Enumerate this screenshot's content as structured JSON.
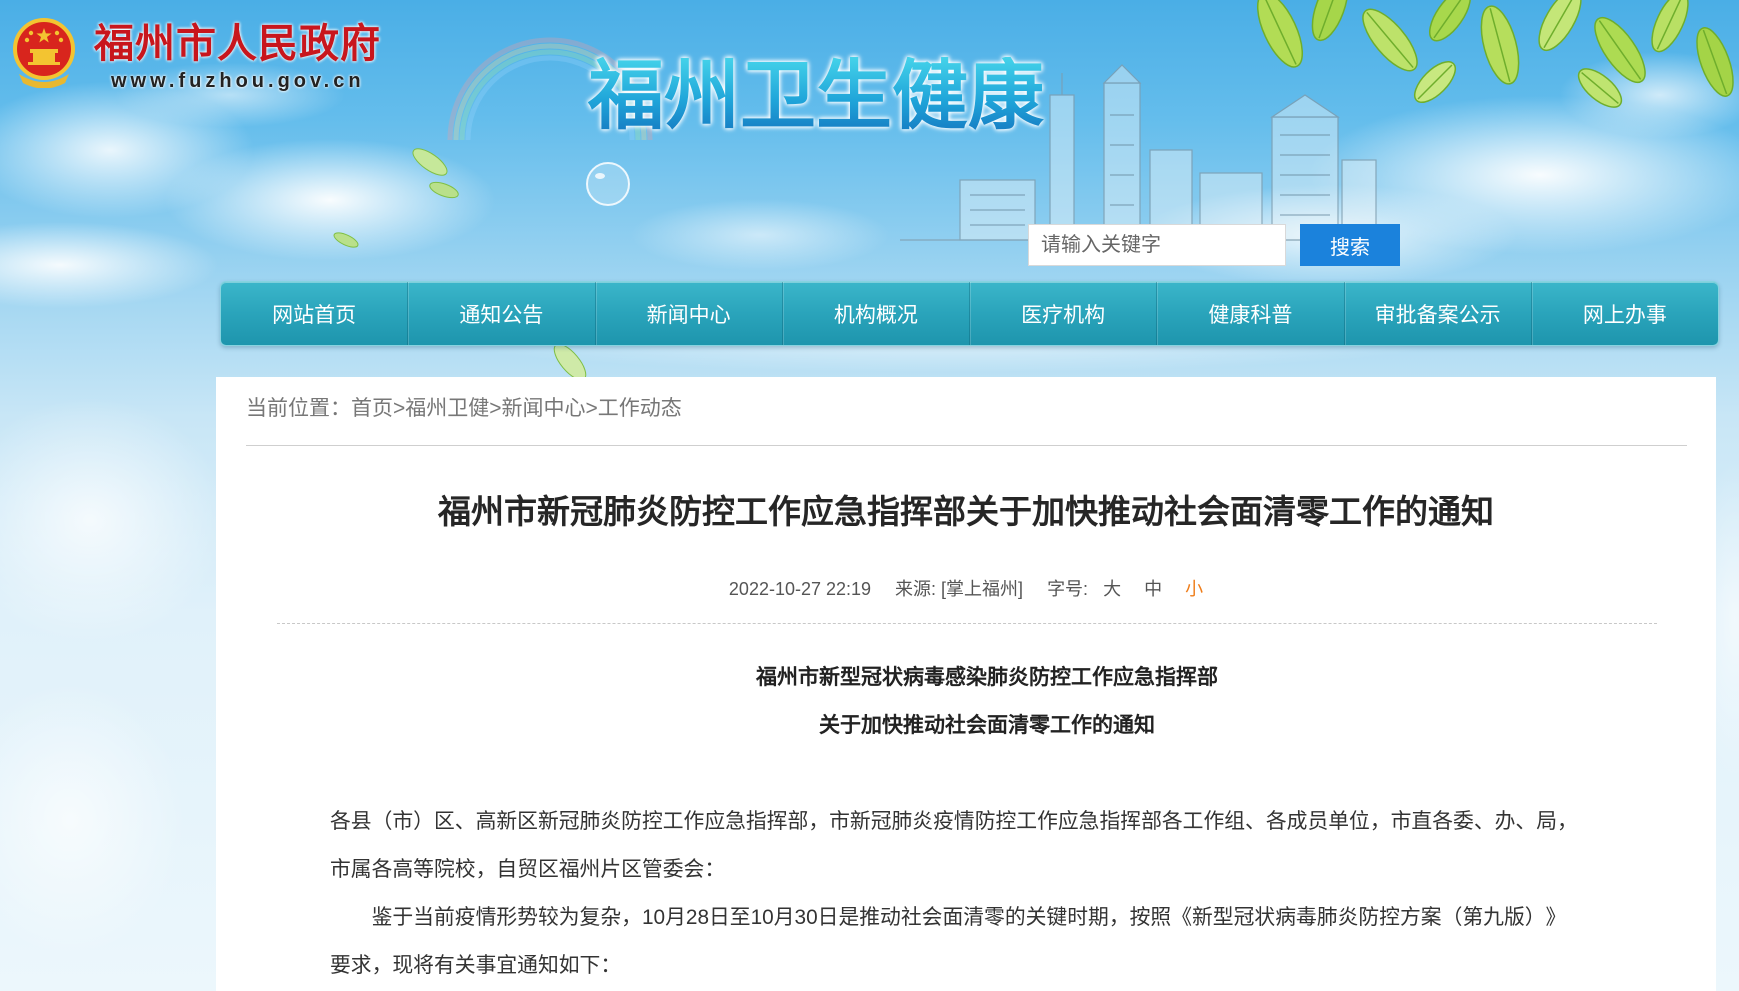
{
  "header": {
    "gov_name": "福州市人民政府",
    "gov_url": "www.fuzhou.gov.cn",
    "banner_title": "福州卫生健康"
  },
  "search": {
    "placeholder": "请输入关键字",
    "button_label": "搜索"
  },
  "nav": {
    "items": [
      {
        "label": "网站首页"
      },
      {
        "label": "通知公告"
      },
      {
        "label": "新闻中心"
      },
      {
        "label": "机构概况"
      },
      {
        "label": "医疗机构"
      },
      {
        "label": "健康科普"
      },
      {
        "label": "审批备案公示"
      },
      {
        "label": "网上办事"
      }
    ]
  },
  "breadcrumb": {
    "prefix": "当前位置：",
    "separator": ">",
    "items": [
      "首页",
      "福州卫健",
      "新闻中心",
      "工作动态"
    ]
  },
  "article": {
    "title": "福州市新冠肺炎防控工作应急指挥部关于加快推动社会面清零工作的通知",
    "date": "2022-10-27 22:19",
    "source": "来源: [掌上福州]",
    "font_size_label": "字号:",
    "font_sizes": [
      "大",
      "中",
      "小"
    ],
    "selected_font_size": "小",
    "subtitle_lines": [
      "福州市新型冠状病毒感染肺炎防控工作应急指挥部",
      "关于加快推动社会面清零工作的通知"
    ],
    "paragraphs": [
      "各县（市）区、高新区新冠肺炎防控工作应急指挥部，市新冠肺炎疫情防控工作应急指挥部各工作组、各成员单位，市直各委、办、局，市属各高等院校，自贸区福州片区管委会：",
      "鉴于当前疫情形势较为复杂，10月28日至10月30日是推动社会面清零的关键时期，按照《新型冠状病毒肺炎防控方案（第九版）》要求，现将有关事宜通知如下："
    ]
  },
  "icons": {
    "emblem": "national-emblem-icon",
    "leaves": "leaf-decoration-icon",
    "skyline": "city-skyline-icon",
    "rainbow": "rainbow-icon",
    "bubble": "bubble-icon"
  },
  "colors": {
    "gov_red": "#c8161d",
    "banner_blue": "#1fa4d9",
    "nav_teal": "#2aa4bb",
    "search_button": "#1b82dc",
    "active_font_size": "#ef7d1a",
    "panel_background": "#ffffff"
  }
}
